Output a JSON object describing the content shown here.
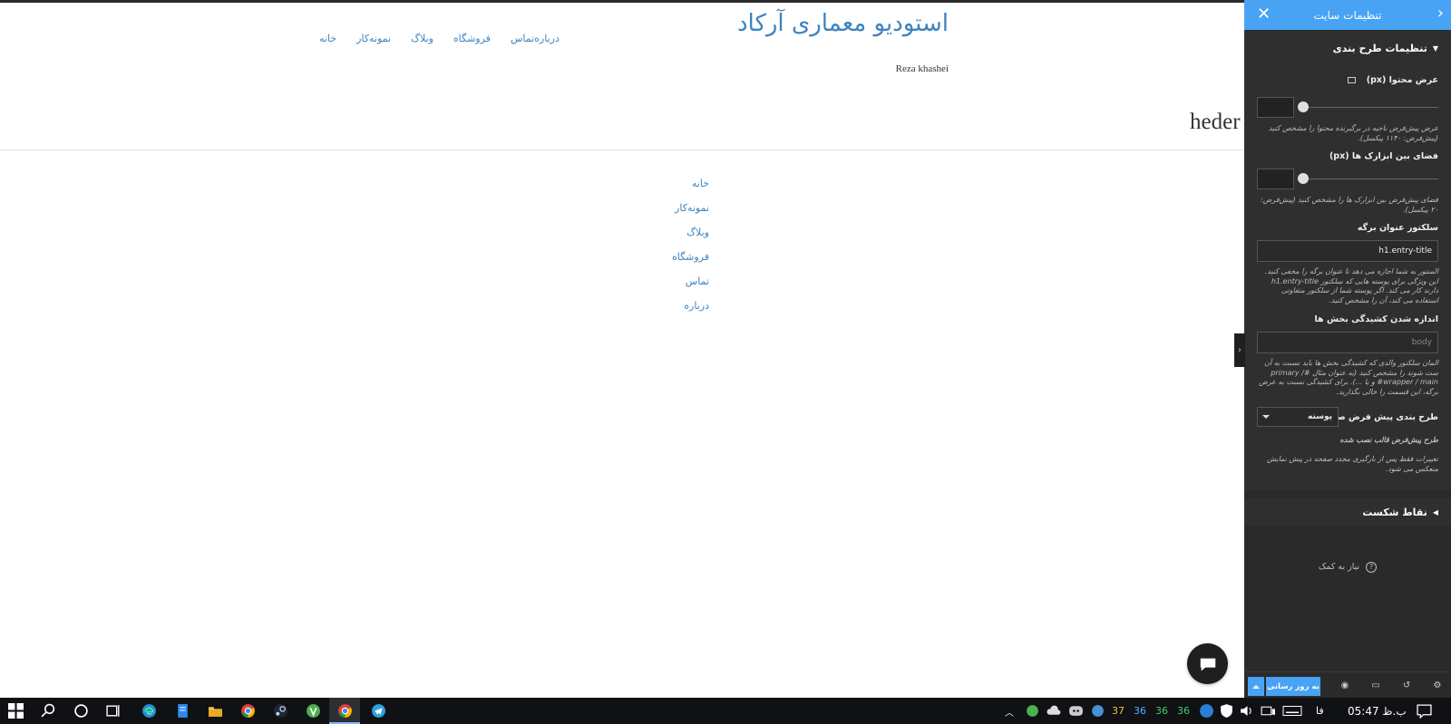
{
  "site": {
    "title": "استودیو معماری آرکاد",
    "tagline": "Reza khashei",
    "heading_fragment": "heder"
  },
  "top_nav": [
    "خانه",
    "نمونه‌کار",
    "وبلاگ",
    "فروشگاه",
    "تماس",
    "درباره"
  ],
  "side_menu": [
    "خانه",
    "نمونه‌کار",
    "وبلاگ",
    "فروشگاه",
    "تماس",
    "درباره"
  ],
  "panel": {
    "header_title": "تنظیمات سایت",
    "layout_section_title": "تنظیمات طرح بندی",
    "content_width": {
      "label": "عرض محتوا (px)",
      "value": "",
      "description": "عرض پیش‌فرض ناحیه در برگیرنده محتوا را مشخص کنید (پیش‌فرض: ۱۱۴۰ پیکسل)."
    },
    "widget_spacing": {
      "label": "فضای بین ابزارک ها (px)",
      "value": "",
      "description": "فضای پیش‌فرض بین ابزارک ها را مشخص کنید (پیش‌فرض: ۲۰ پیکسل)."
    },
    "page_title_selector": {
      "label": "سلکتور عنوان برگه",
      "value": "h1.entry-title",
      "description": "المنتور به شما اجازه می دهد تا عنوان برگه را مخفی کنید. این ویژگی برای پوسته هایی که سلکتور h1.entry-title دارند کار می کند. اگر پوسته شما از سلکتور متفاوتی استفاده می کند، آن را مشخص کنید."
    },
    "stretched_section": {
      "label": "اندازه شدن کشیدگی بخش ها",
      "placeholder": "body",
      "description": "المان سلکتور والدی که کشیدگی بخش ها باید نسبت به آن ست شوند را مشخص کنید (به عنوان مثال #primary / #wrapper / main و یا ...). برای کشیدگی نسبت به عرض برگه، این قسمت را خالی بگذارید."
    },
    "default_layout": {
      "label": "طرح بندی پیش فرض صفحه",
      "selected": "پوسته"
    },
    "theme_default_note": "طرح پیش‌فرض قالب نصب شده",
    "reload_note": "تغییرات فقط پس از بارگیری مجدد صفحه در پیش نمایش منعکس می شود.",
    "breakpoints_title": "نقاط شکست",
    "help_label": "نیاز به کمک",
    "publish_label": "به روز رسانی"
  },
  "taskbar": {
    "tray_numbers": [
      "37",
      "36",
      "36",
      "36"
    ],
    "tray_number_colors": [
      "#f2c14e",
      "#4fb0ff",
      "#3ccf6e",
      "#3ccf6e"
    ],
    "language": "فا",
    "clock": "05:47 ب.ظ"
  },
  "colors": {
    "accent": "#49a3f5",
    "link": "#3f83c0",
    "panel_bg": "#2a2a2a"
  }
}
